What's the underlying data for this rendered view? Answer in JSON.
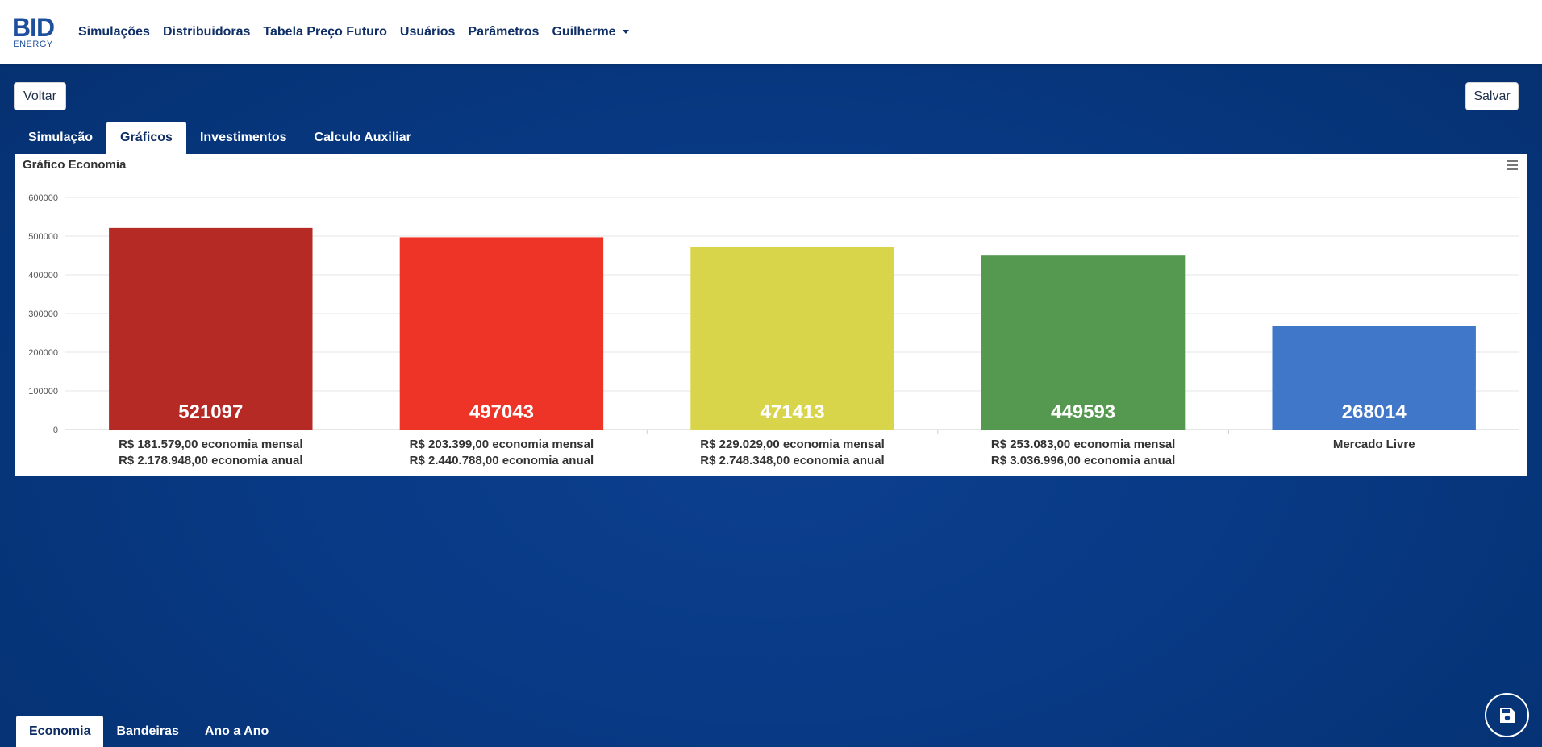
{
  "brand": {
    "logo_main": "BID",
    "logo_sub": "ENERGY"
  },
  "nav": {
    "items": [
      "Simulações",
      "Distribuidoras",
      "Tabela Preço Futuro",
      "Usuários",
      "Parâmetros"
    ],
    "user": "Guilherme"
  },
  "actions": {
    "back_label": "Voltar",
    "save_label": "Salvar"
  },
  "top_tabs": [
    {
      "label": "Simulação",
      "active": false
    },
    {
      "label": "Gráficos",
      "active": true
    },
    {
      "label": "Investimentos",
      "active": false
    },
    {
      "label": "Calculo Auxiliar",
      "active": false
    }
  ],
  "bottom_tabs": [
    {
      "label": "Economia",
      "active": true
    },
    {
      "label": "Bandeiras",
      "active": false
    },
    {
      "label": "Ano a Ano",
      "active": false
    }
  ],
  "icons": {
    "menu": "hamburger-menu-icon",
    "fab": "floppy-disk-save-icon",
    "caret": "caret-down-icon"
  },
  "chart_data": {
    "type": "bar",
    "title": "Gráfico Economia",
    "ylim": [
      0,
      600000
    ],
    "yticks": [
      "0",
      "100000",
      "200000",
      "300000",
      "400000",
      "500000",
      "600000"
    ],
    "grid": true,
    "categories": [
      [
        "R$ 181.579,00 economia mensal",
        "R$ 2.178.948,00 economia anual"
      ],
      [
        "R$ 203.399,00 economia mensal",
        "R$ 2.440.788,00 economia anual"
      ],
      [
        "R$ 229.029,00 economia mensal",
        "R$ 2.748.348,00 economia anual"
      ],
      [
        "R$ 253.083,00 economia mensal",
        "R$ 3.036.996,00 economia anual"
      ],
      [
        "Mercado Livre"
      ]
    ],
    "values": [
      521097,
      497043,
      471413,
      449593,
      268014
    ],
    "colors": [
      "#b52a25",
      "#ee3327",
      "#d9d54b",
      "#55984f",
      "#4177c9"
    ]
  }
}
